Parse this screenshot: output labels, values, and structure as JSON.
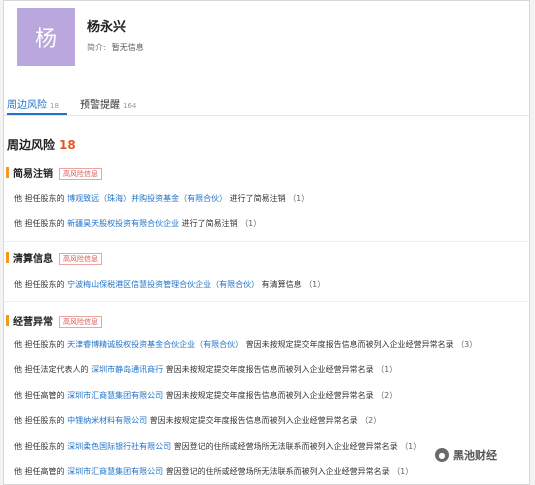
{
  "profile": {
    "avatar_char": "杨",
    "name": "杨永兴",
    "intro_label": "简介:",
    "intro_value": "暂无信息"
  },
  "tabs": [
    {
      "label": "周边风险",
      "count": "18"
    },
    {
      "label": "预警提醒",
      "count": "164"
    }
  ],
  "section": {
    "title": "周边风险",
    "count": "18"
  },
  "groups": [
    {
      "title": "简易注销",
      "badge": "高风险信息",
      "rows": [
        {
          "prefix": "他 担任股东的",
          "company": "博观致远（珠海）并购投资基金（有限合伙）",
          "suffix": "进行了简易注销",
          "count": "（1）"
        },
        {
          "prefix": "他 担任股东的",
          "company": "新疆昊天股权投资有限合伙企业",
          "suffix": "进行了简易注销",
          "count": "（1）"
        }
      ]
    },
    {
      "title": "清算信息",
      "badge": "高风险信息",
      "rows": [
        {
          "prefix": "他 担任股东的",
          "company": "宁波梅山保税港区信慧投资管理合伙企业（有限合伙）",
          "suffix": "有清算信息",
          "count": "（1）"
        }
      ]
    },
    {
      "title": "经营异常",
      "badge": "高风险信息",
      "rows": [
        {
          "prefix": "他 担任股东的",
          "company": "天津睿博精诚股权投资基金合伙企业（有限合伙）",
          "suffix": "曾因未按规定提交年度报告信息而被列入企业经营异常名录",
          "count": "（3）"
        },
        {
          "prefix": "他 担任法定代表人的",
          "company": "深圳市静岛通讯商行",
          "suffix": "曾因未按规定提交年度报告信息而被列入企业经营异常名录",
          "count": "（1）"
        },
        {
          "prefix": "他 担任高管的",
          "company": "深圳市汇商慧集团有限公司",
          "suffix": "曾因未按规定提交年度报告信息而被列入企业经营异常名录",
          "count": "（2）"
        },
        {
          "prefix": "他 担任股东的",
          "company": "中锂纳米材料有限公司",
          "suffix": "曾因未按规定提交年度报告信息而被列入企业经营异常名录",
          "count": "（2）"
        },
        {
          "prefix": "他 担任股东的",
          "company": "深圳柔色国际银行社有限公司",
          "suffix": "曾因登记的住所或经营场所无法联系而被列入企业经营异常名录",
          "count": "（1）"
        },
        {
          "prefix": "他 担任高管的",
          "company": "深圳市汇商慧集团有限公司",
          "suffix": "曾因登记的住所或经营场所无法联系而被列入企业经营异常名录",
          "count": "（1）"
        }
      ]
    }
  ],
  "watermark": {
    "text": "黑池财经"
  }
}
